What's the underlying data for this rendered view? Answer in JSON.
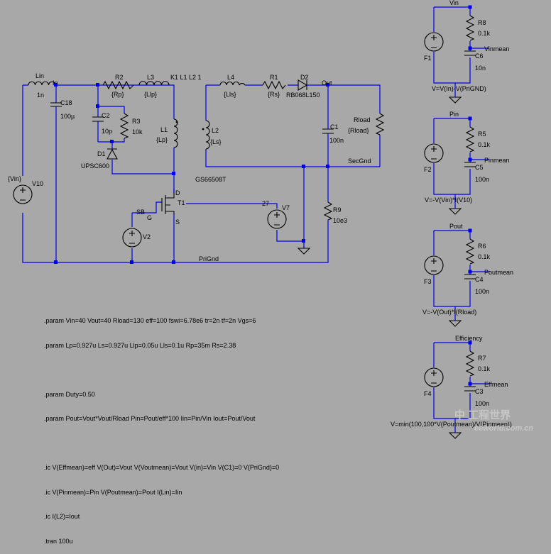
{
  "components": {
    "Lin": {
      "name": "Lin",
      "value": "1n"
    },
    "C18": {
      "name": "C18",
      "value": "100µ"
    },
    "R2": {
      "name": "R2",
      "value": "{Rp}"
    },
    "L3": {
      "name": "L3",
      "value": "{Llp}"
    },
    "C2": {
      "name": "C2",
      "value": "10p"
    },
    "R3": {
      "name": "R3",
      "value": "10k"
    },
    "D1": {
      "name": "D1",
      "value": "UPSC600"
    },
    "L1": {
      "name": "L1",
      "value": "{Lp}"
    },
    "K1": {
      "label": "K1 L1 L2 1"
    },
    "L4": {
      "name": "L4",
      "value": "{Lls}"
    },
    "R1": {
      "name": "R1",
      "value": "{Rs}"
    },
    "D2": {
      "name": "D2",
      "value": "RB068L150"
    },
    "L2": {
      "name": "L2",
      "value": "{Ls}"
    },
    "C1": {
      "name": "C1",
      "value": "100n"
    },
    "Rload": {
      "name": "Rload",
      "value": "{Rload}"
    },
    "V10": {
      "name": "V10",
      "value": "{Vin}"
    },
    "M1": {
      "model": "GS66508T",
      "drain": "D",
      "gate": "G",
      "source": "S",
      "sb": "SB"
    },
    "V2": {
      "name": "V2"
    },
    "V7": {
      "name": "V7",
      "pin": "27"
    },
    "R9": {
      "name": "R9",
      "value": "10e3"
    },
    "T1": {
      "label": "T1"
    }
  },
  "nets": {
    "in": "In",
    "out": "Out",
    "secgnd": "SecGnd",
    "prignd": "PriGnd"
  },
  "meters": [
    {
      "title": "Vin",
      "R": "R8",
      "Rval": "0.1k",
      "C": "C6",
      "Cval": "10n",
      "F": "F1",
      "net": "Vinmean",
      "expr": "V=V(In)-V(PriGND)"
    },
    {
      "title": "Pin",
      "R": "R5",
      "Rval": "0.1k",
      "C": "C5",
      "Cval": "100n",
      "F": "F2",
      "net": "Pinmean",
      "expr": "V=-V(Vin)*I(V10)"
    },
    {
      "title": "Pout",
      "R": "R6",
      "Rval": "0.1k",
      "C": "C4",
      "Cval": "100n",
      "F": "F3",
      "net": "Poutmean",
      "expr": "V=-V(Out)*I(Rload)"
    },
    {
      "title": "Efficiency",
      "R": "R7",
      "Rval": "0.1k",
      "C": "C3",
      "Cval": "100n",
      "F": "F4",
      "net": "Effmean",
      "expr": "V=min(100,100*V(Poutmean)/V(Pinmean))"
    }
  ],
  "directives": [
    ".param Vin=40 Vout=40 Rload=130 eff=100 fswi=6.78e6 tr=2n tf=2n Vgs=6",
    ".param Lp=0.927u Ls=0.927u Llp=0.05u Lls=0.1u Rp=35m Rs=2.38",
    "",
    ".param Duty=0.50",
    ".param Pout=Vout*Vout/Rload Pin=Pout/eff*100 Iin=Pin/Vin Iout=Pout/Vout",
    "",
    ".ic V(Effmean)=eff V(Out)=Vout V(Voutmean)=Vout V(in)=Vin V(C1)=0 V(PriGnd)=0",
    ".ic V(Pinmean)=Pin V(Poutmean)=Pout I(Lin)=Iin",
    ".ic I(L2)=Iout",
    ".tran 100u"
  ],
  "watermark": {
    "line1": "中  工程世界",
    "line2": "eeworld.com.cn"
  },
  "colors": {
    "background": "#a8a8a8",
    "wire": "#0000ee",
    "component": "#000000"
  }
}
